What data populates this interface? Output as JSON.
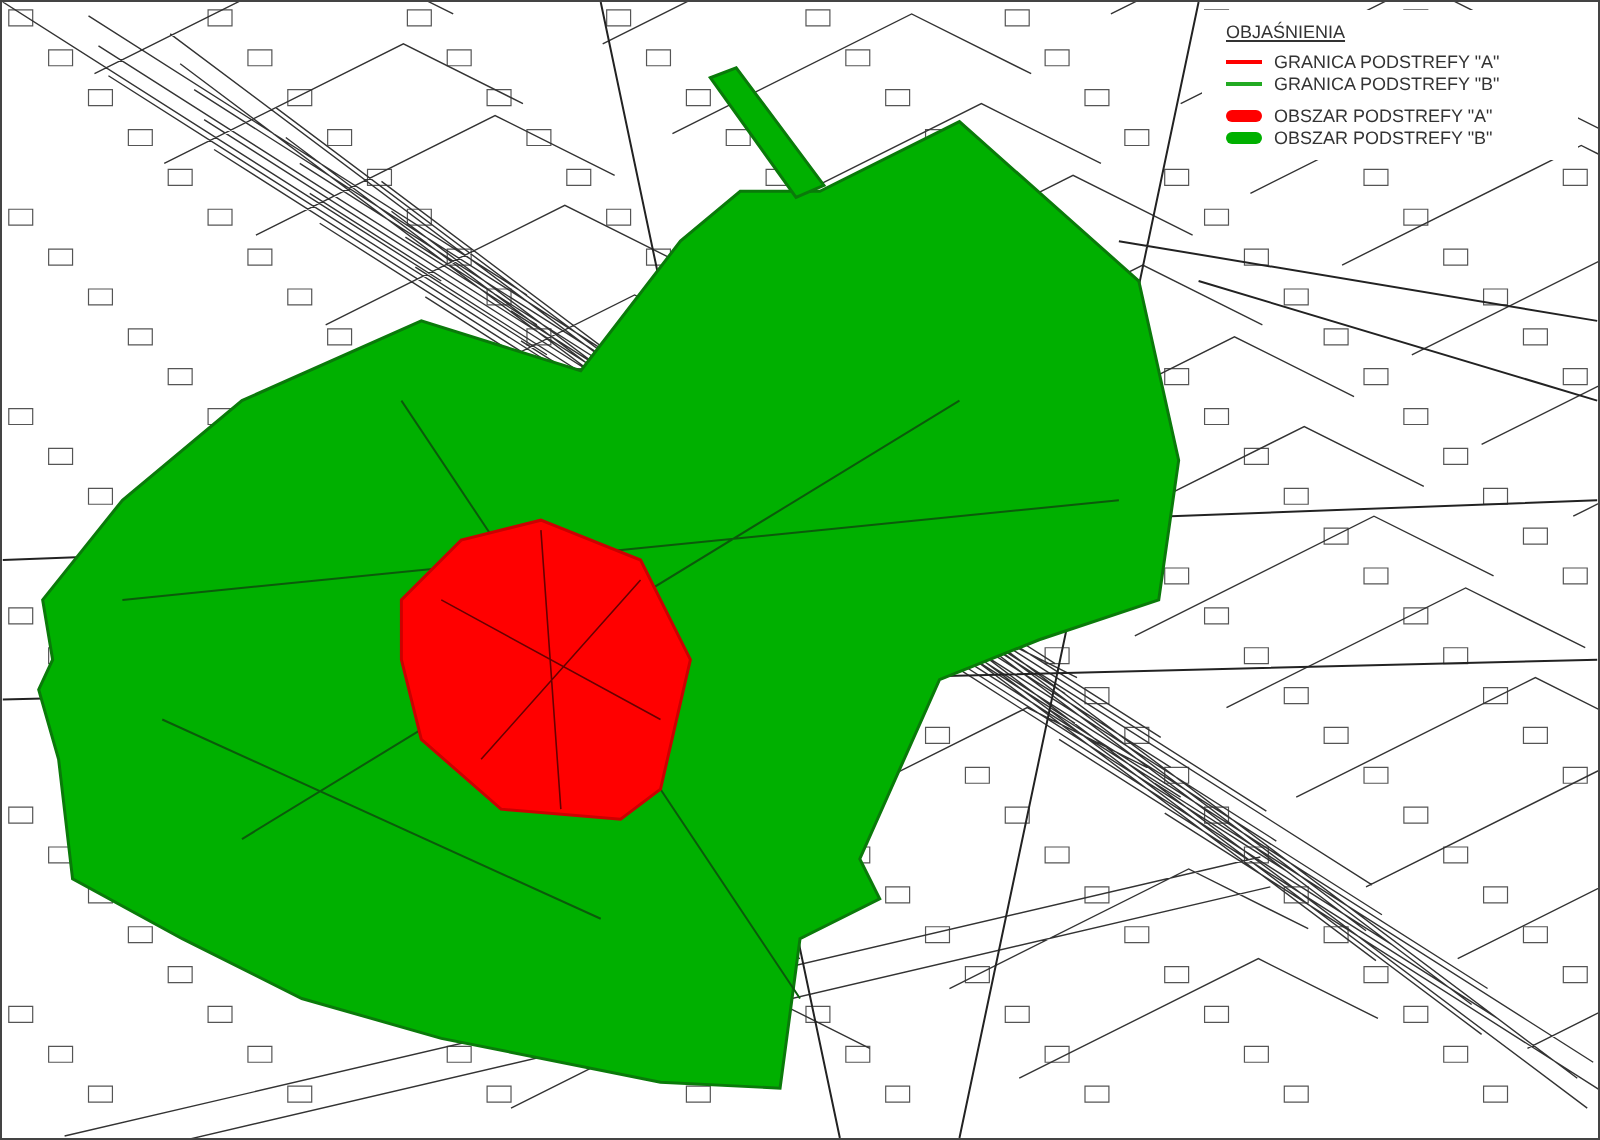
{
  "legend": {
    "title": "OBJAŚNIENIA",
    "items": [
      {
        "kind": "line",
        "color": "#ff0000",
        "label": "GRANICA PODSTREFY \"A\""
      },
      {
        "kind": "line",
        "color": "#22aa22",
        "label": "GRANICA PODSTREFY \"B\""
      },
      {
        "kind": "area",
        "color": "#ff0000",
        "label": "OBSZAR PODSTREFY \"A\""
      },
      {
        "kind": "area",
        "color": "#00b000",
        "label": "OBSZAR PODSTREFY \"B\""
      }
    ]
  }
}
